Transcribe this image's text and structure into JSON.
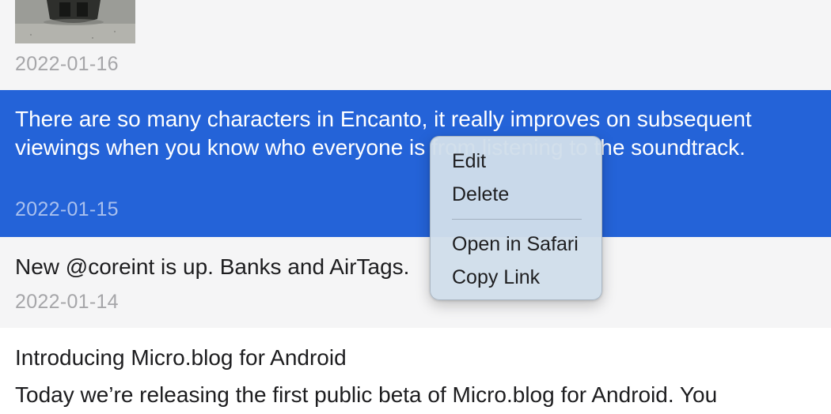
{
  "timeline": {
    "posts": [
      {
        "has_photo": true,
        "date": "2022-01-16"
      },
      {
        "selected": true,
        "text": "There are so many characters in Encanto, it really improves on subsequent viewings when you know who everyone is from listening to the soundtrack.",
        "date": "2022-01-15"
      },
      {
        "text": "New @coreint is up. Banks and AirTags.",
        "date": "2022-01-14"
      },
      {
        "title": "Introducing Micro.blog for Android",
        "text": "Today we’re releasing the first public beta of Micro.blog for Android. You"
      }
    ]
  },
  "context_menu": {
    "items": [
      {
        "label": "Edit"
      },
      {
        "label": "Delete"
      },
      {
        "label": "Open in Safari"
      },
      {
        "label": "Copy Link"
      }
    ]
  },
  "colors": {
    "selection": "#2463d8",
    "row_background": "#f5f5f6",
    "date_text": "#a6a6a9",
    "menu_background": "#d0deea"
  }
}
